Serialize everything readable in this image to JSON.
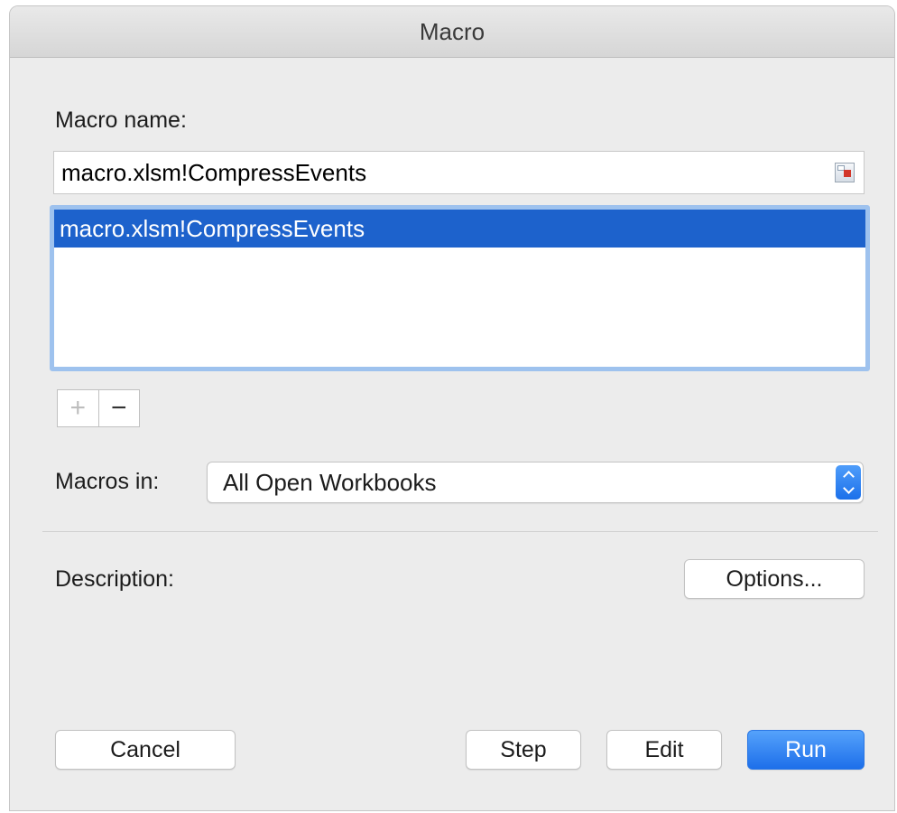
{
  "window": {
    "title": "Macro"
  },
  "macro_name": {
    "label": "Macro name:",
    "value": "macro.xlsm!CompressEvents"
  },
  "macro_list": {
    "items": [
      "macro.xlsm!CompressEvents"
    ],
    "selected": "macro.xlsm!CompressEvents"
  },
  "list_controls": {
    "add": "+",
    "remove": "−"
  },
  "macros_in": {
    "label": "Macros in:",
    "selected": "All Open Workbooks"
  },
  "description": {
    "label": "Description:"
  },
  "buttons": {
    "options": "Options...",
    "cancel": "Cancel",
    "step": "Step",
    "edit": "Edit",
    "run": "Run"
  },
  "colors": {
    "selection": "#1d62cc",
    "accent": "#1d6fea",
    "focus_ring": "#9ec2ee"
  },
  "icons": {
    "collapse_dialog": "range-select-icon",
    "popup_stepper": "up-down-chevron-icon"
  }
}
